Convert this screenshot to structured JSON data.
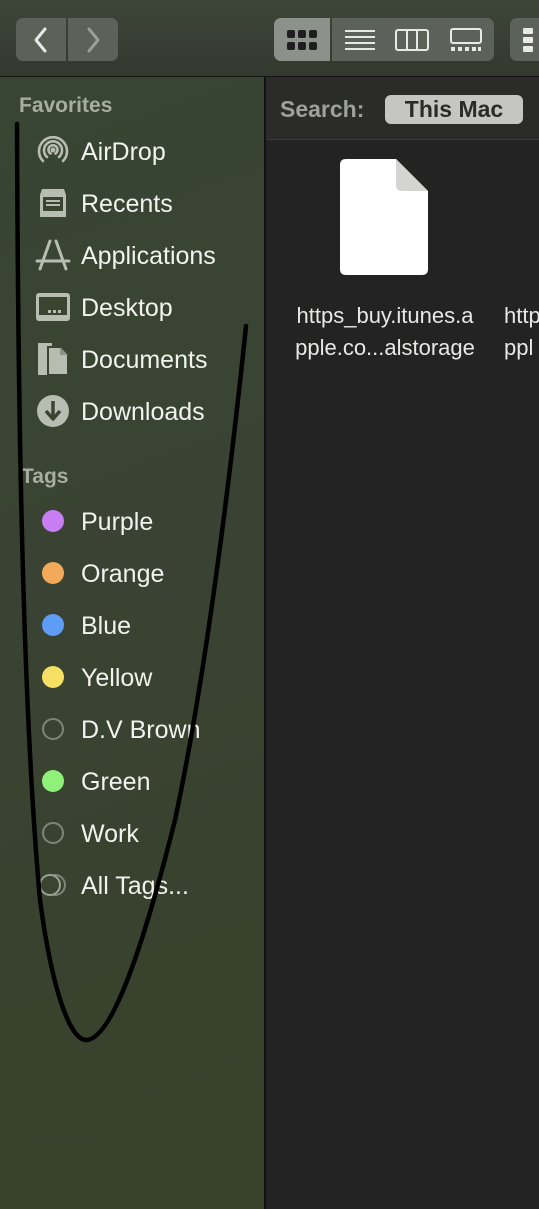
{
  "toolbar": {
    "back_icon": "chevron-left-icon",
    "forward_icon": "chevron-right-icon",
    "views": [
      {
        "icon": "icon-grid-icon",
        "selected": true
      },
      {
        "icon": "list-view-icon",
        "selected": false
      },
      {
        "icon": "column-view-icon",
        "selected": false
      },
      {
        "icon": "gallery-view-icon",
        "selected": false
      }
    ]
  },
  "sidebar": {
    "favorites_title": "Favorites",
    "favorites": [
      {
        "label": "AirDrop",
        "icon": "airdrop-icon"
      },
      {
        "label": "Recents",
        "icon": "recents-icon"
      },
      {
        "label": "Applications",
        "icon": "applications-icon"
      },
      {
        "label": "Desktop",
        "icon": "desktop-icon"
      },
      {
        "label": "Documents",
        "icon": "documents-icon"
      },
      {
        "label": "Downloads",
        "icon": "downloads-icon"
      }
    ],
    "tags_title": "Tags",
    "tags": [
      {
        "label": "Purple",
        "color": "#c77ef2"
      },
      {
        "label": "Orange",
        "color": "#f2aa5a"
      },
      {
        "label": "Blue",
        "color": "#5e9cf6"
      },
      {
        "label": "Yellow",
        "color": "#f5e064"
      },
      {
        "label": "D.V Brown",
        "color": "hollow"
      },
      {
        "label": "Green",
        "color": "#8ff07a"
      },
      {
        "label": "Work",
        "color": "hollow"
      },
      {
        "label": "All Tags...",
        "color": "all"
      }
    ]
  },
  "search": {
    "label": "Search:",
    "scope": "This Mac"
  },
  "files": [
    {
      "line1": "https_buy.itunes.a",
      "line2": "pple.co...alstorage"
    },
    {
      "line1": "https",
      "line2": "ppl"
    }
  ]
}
